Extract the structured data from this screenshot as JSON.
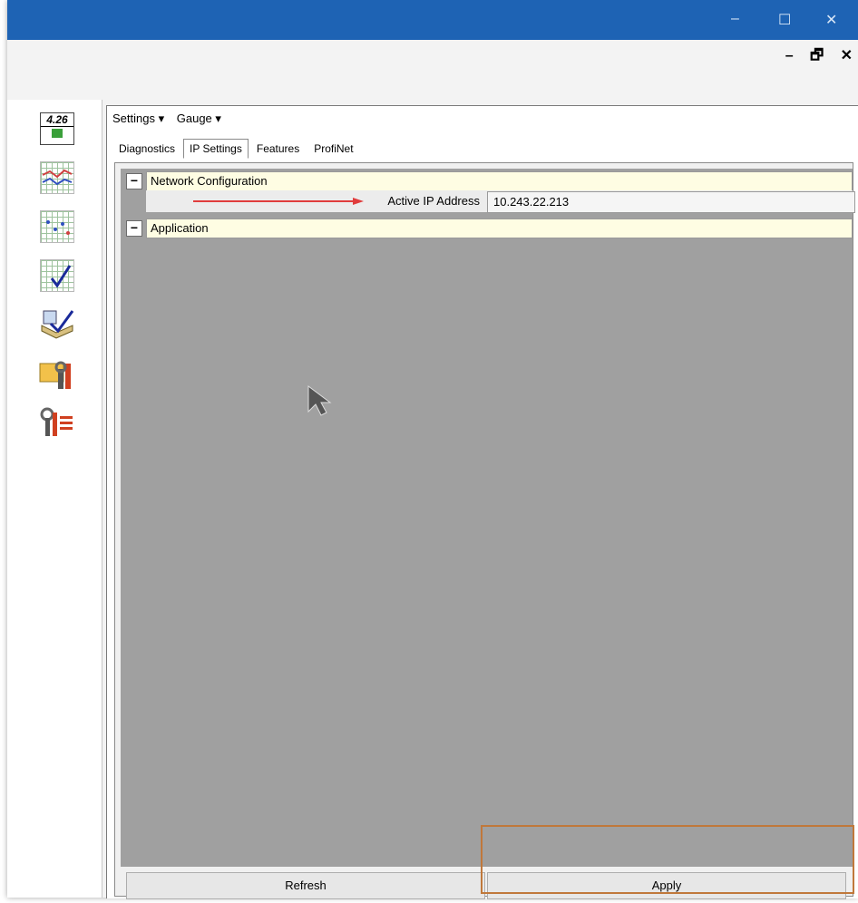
{
  "window": {
    "controls": [
      "–",
      "☐",
      "✕"
    ],
    "mdi_controls": [
      "–",
      "🗗",
      "✕"
    ]
  },
  "toolbar": {
    "tools": [
      {
        "name": "version-icon",
        "text": "4.26"
      },
      {
        "name": "chart-line-icon"
      },
      {
        "name": "chart-scatter-icon"
      },
      {
        "name": "chart-check-icon"
      },
      {
        "name": "book-check-icon"
      },
      {
        "name": "folder-tools-icon"
      },
      {
        "name": "tools-list-icon"
      }
    ]
  },
  "menu": {
    "settings": "Settings ▾",
    "gauge": "Gauge ▾"
  },
  "tabs": [
    "Diagnostics",
    "IP Settings",
    "Features",
    "ProfiNet"
  ],
  "active_tab": "IP Settings",
  "properties": {
    "network_category": "Network Configuration",
    "active_ip_label": "Active IP Address",
    "active_ip_value": "10.243.22.213",
    "application_category": "Application"
  },
  "buttons": {
    "refresh": "Refresh",
    "apply": "Apply"
  },
  "colors": {
    "title_bar": "#1e63b4",
    "category_bg": "#fefde3",
    "highlight": "#c0783b",
    "arrow": "#e03c3c"
  }
}
